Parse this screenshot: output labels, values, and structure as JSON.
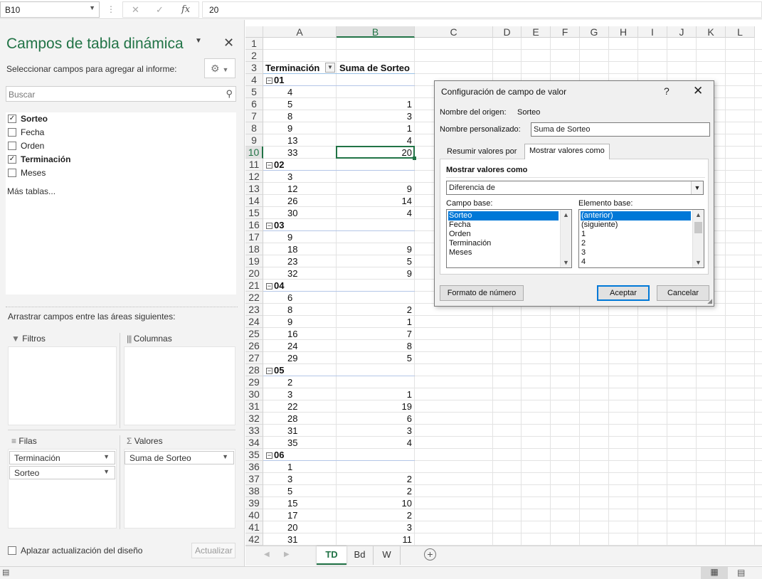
{
  "formula_bar": {
    "name_box": "B10",
    "formula": "20"
  },
  "pivot_pane": {
    "title": "Campos de tabla dinámica",
    "subtitle": "Seleccionar campos para agregar al informe:",
    "search_placeholder": "Buscar",
    "fields": [
      {
        "label": "Sorteo",
        "checked": true
      },
      {
        "label": "Fecha",
        "checked": false
      },
      {
        "label": "Orden",
        "checked": false
      },
      {
        "label": "Terminación",
        "checked": true
      },
      {
        "label": "Meses",
        "checked": false
      }
    ],
    "more_tables": "Más tablas...",
    "drag_hint": "Arrastrar campos entre las áreas siguientes:",
    "zones": {
      "filters": "Filtros",
      "columns": "Columnas",
      "rows": "Filas",
      "values": "Valores"
    },
    "rows_items": [
      "Terminación",
      "Sorteo"
    ],
    "values_items": [
      "Suma de Sorteo"
    ],
    "defer_label": "Aplazar actualización del diseño",
    "update_button": "Actualizar"
  },
  "grid": {
    "columns": [
      "A",
      "B",
      "C",
      "D",
      "E",
      "F",
      "G",
      "H",
      "I",
      "J",
      "K",
      "L"
    ],
    "rows": [
      "1",
      "2",
      "3",
      "4",
      "5",
      "6",
      "7",
      "8",
      "9",
      "10",
      "11",
      "12",
      "13",
      "14",
      "15",
      "16",
      "17",
      "18",
      "19",
      "20",
      "21",
      "22",
      "23",
      "24",
      "25",
      "26",
      "27",
      "28",
      "29",
      "30",
      "31",
      "32",
      "33",
      "34",
      "35",
      "36",
      "37",
      "38",
      "39",
      "40",
      "41",
      "42"
    ],
    "header_a": "Terminación",
    "header_b": "Suma de Sorteo",
    "cells": [
      {
        "row": 4,
        "a": "01",
        "b": "",
        "group": true
      },
      {
        "row": 5,
        "a": "4",
        "b": ""
      },
      {
        "row": 6,
        "a": "5",
        "b": "1"
      },
      {
        "row": 7,
        "a": "8",
        "b": "3"
      },
      {
        "row": 8,
        "a": "9",
        "b": "1"
      },
      {
        "row": 9,
        "a": "13",
        "b": "4"
      },
      {
        "row": 10,
        "a": "33",
        "b": "20"
      },
      {
        "row": 11,
        "a": "02",
        "b": "",
        "group": true
      },
      {
        "row": 12,
        "a": "3",
        "b": ""
      },
      {
        "row": 13,
        "a": "12",
        "b": "9"
      },
      {
        "row": 14,
        "a": "26",
        "b": "14"
      },
      {
        "row": 15,
        "a": "30",
        "b": "4"
      },
      {
        "row": 16,
        "a": "03",
        "b": "",
        "group": true
      },
      {
        "row": 17,
        "a": "9",
        "b": ""
      },
      {
        "row": 18,
        "a": "18",
        "b": "9"
      },
      {
        "row": 19,
        "a": "23",
        "b": "5"
      },
      {
        "row": 20,
        "a": "32",
        "b": "9"
      },
      {
        "row": 21,
        "a": "04",
        "b": "",
        "group": true
      },
      {
        "row": 22,
        "a": "6",
        "b": ""
      },
      {
        "row": 23,
        "a": "8",
        "b": "2"
      },
      {
        "row": 24,
        "a": "9",
        "b": "1"
      },
      {
        "row": 25,
        "a": "16",
        "b": "7"
      },
      {
        "row": 26,
        "a": "24",
        "b": "8"
      },
      {
        "row": 27,
        "a": "29",
        "b": "5"
      },
      {
        "row": 28,
        "a": "05",
        "b": "",
        "group": true
      },
      {
        "row": 29,
        "a": "2",
        "b": ""
      },
      {
        "row": 30,
        "a": "3",
        "b": "1"
      },
      {
        "row": 31,
        "a": "22",
        "b": "19"
      },
      {
        "row": 32,
        "a": "28",
        "b": "6"
      },
      {
        "row": 33,
        "a": "31",
        "b": "3"
      },
      {
        "row": 34,
        "a": "35",
        "b": "4"
      },
      {
        "row": 35,
        "a": "06",
        "b": "",
        "group": true
      },
      {
        "row": 36,
        "a": "1",
        "b": ""
      },
      {
        "row": 37,
        "a": "3",
        "b": "2"
      },
      {
        "row": 38,
        "a": "5",
        "b": "2"
      },
      {
        "row": 39,
        "a": "15",
        "b": "10"
      },
      {
        "row": 40,
        "a": "17",
        "b": "2"
      },
      {
        "row": 41,
        "a": "20",
        "b": "3"
      },
      {
        "row": 42,
        "a": "31",
        "b": "11"
      }
    ]
  },
  "dialog": {
    "title": "Configuración de campo de valor",
    "source_label": "Nombre del origen:",
    "source_value": "Sorteo",
    "custom_name_label": "Nombre personalizado:",
    "custom_name_value": "Suma de Sorteo",
    "tab_summarize": "Resumir valores por",
    "tab_show": "Mostrar valores como",
    "section_label": "Mostrar valores como",
    "show_as_value": "Diferencia de",
    "base_field_label": "Campo base:",
    "base_fields": [
      "Sorteo",
      "Fecha",
      "Orden",
      "Terminación",
      "Meses"
    ],
    "base_item_label": "Elemento base:",
    "base_items": [
      "(anterior)",
      "(siguiente)",
      "1",
      "2",
      "3",
      "4"
    ],
    "number_format_button": "Formato de número",
    "ok_button": "Aceptar",
    "cancel_button": "Cancelar"
  },
  "sheet_tabs": [
    "TD",
    "Bd",
    "W"
  ],
  "colors": {
    "accent": "#217346",
    "selection": "#0078d7"
  }
}
